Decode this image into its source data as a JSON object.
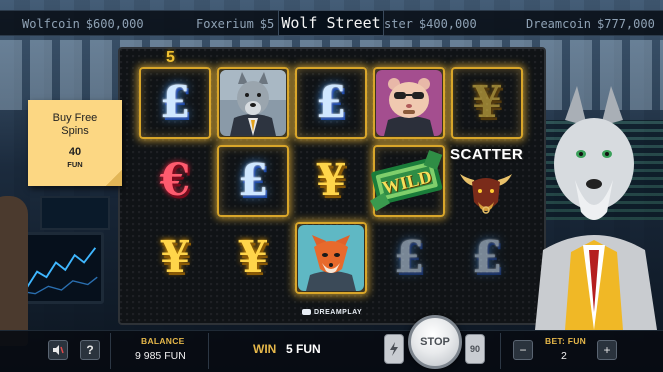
{
  "game": {
    "title": "Wolf Street"
  },
  "ticker": [
    {
      "name": "Wolfcoin",
      "value": "$600,000"
    },
    {
      "name": "Foxerium",
      "value": "$5"
    },
    {
      "name": "ster",
      "value": "$400,000"
    },
    {
      "name": "Dreamcoin",
      "value": "$777,000"
    }
  ],
  "reels": {
    "top_counter": "5",
    "grid": [
      [
        "pound",
        "euro",
        "yen"
      ],
      [
        "wolf",
        "pound",
        "yen"
      ],
      [
        "pound",
        "yen",
        "fox"
      ],
      [
        "hamster",
        "wild",
        "pound"
      ],
      [
        "yen",
        "bull",
        "pound"
      ]
    ],
    "wild_label": "WILD",
    "scatter_label": "SCATTER"
  },
  "buy_free_spins": {
    "label": "Buy Free Spins",
    "price": "40",
    "currency": "FUN"
  },
  "provider": "DREAMPLAY",
  "bottom_bar": {
    "balance_label": "BALANCE",
    "balance_value": "9 985 FUN",
    "win_label": "WIN",
    "win_value": "5 FUN",
    "stop_label": "STOP",
    "autoplay_count": "90",
    "bet_label": "BET: FUN",
    "bet_value": "2",
    "minus": "−",
    "plus": "+",
    "help": "?"
  },
  "icons": {
    "sound": "speaker-icon",
    "turbo": "lightning-icon"
  },
  "colors": {
    "accent_gold": "#e6b84a",
    "win_glow": "#d9a62a"
  }
}
